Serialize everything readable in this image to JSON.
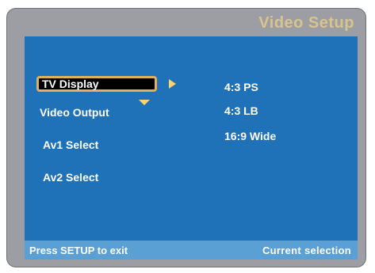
{
  "header": {
    "title": "Video Setup"
  },
  "menu": {
    "items": [
      {
        "label": "TV Display",
        "selected": true
      },
      {
        "label": "Video Output",
        "selected": false
      },
      {
        "label": "Av1 Select",
        "selected": false
      },
      {
        "label": "Av2 Select",
        "selected": false
      }
    ]
  },
  "options": [
    {
      "label": "4:3 PS"
    },
    {
      "label": "4:3 LB"
    },
    {
      "label": "16:9 Wide"
    }
  ],
  "status_bar": {
    "left": "Press SETUP to exit",
    "right": "Current  selection"
  },
  "colors": {
    "panel_bg": "#1f72b8",
    "frame_bg": "#9c9ea3",
    "title": "#d8c48e",
    "highlight_border": "#e0b060",
    "arrow": "#ffd26a",
    "status_bg": "#5aa0d5"
  },
  "icons": {
    "submenu_arrow": "right-triangle-icon",
    "scroll_indicator": "down-triangle-icon"
  }
}
